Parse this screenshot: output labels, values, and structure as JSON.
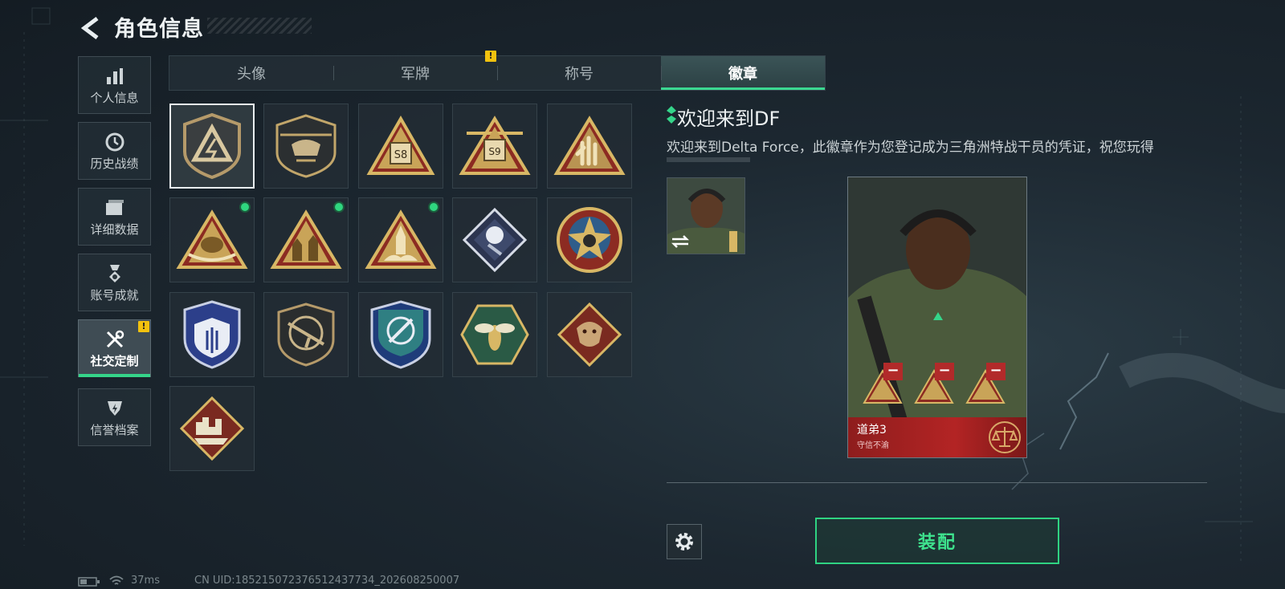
{
  "header": {
    "title": "角色信息",
    "back_icon": "chevron-left-icon"
  },
  "sidebar": {
    "items": [
      {
        "label": "个人信息",
        "icon": "bar-chart-icon"
      },
      {
        "label": "历史战绩",
        "icon": "history-clock-icon"
      },
      {
        "label": "详细数据",
        "icon": "folder-data-icon"
      },
      {
        "label": "账号成就",
        "icon": "medal-icon"
      },
      {
        "label": "社交定制",
        "icon": "tools-icon",
        "active": true,
        "warning": "!"
      },
      {
        "label": "信誉档案",
        "icon": "shield-bolt-icon"
      }
    ]
  },
  "tabs": [
    {
      "label": "头像"
    },
    {
      "label": "军牌",
      "warning": "!"
    },
    {
      "label": "称号"
    },
    {
      "label": "徽章",
      "active": true
    }
  ],
  "badges": [
    {
      "name": "delta-shield-badge",
      "selected": true
    },
    {
      "name": "helicopter-badge"
    },
    {
      "name": "s8-badge"
    },
    {
      "name": "s9-badge"
    },
    {
      "name": "hand-sign-badge"
    },
    {
      "name": "eagle-triangle-badge",
      "new": true
    },
    {
      "name": "soldiers-triangle-badge",
      "new": true
    },
    {
      "name": "rocket-triangle-badge",
      "new": true
    },
    {
      "name": "rose-diamond-badge"
    },
    {
      "name": "star-round-badge"
    },
    {
      "name": "blue-shield-badge"
    },
    {
      "name": "rifle-badge"
    },
    {
      "name": "target-blue-badge"
    },
    {
      "name": "hornet-hex-badge"
    },
    {
      "name": "dragon-diamond-badge"
    },
    {
      "name": "city-diamond-badge"
    }
  ],
  "detail": {
    "title": "欢迎来到DF",
    "description": "欢迎来到Delta Force，此徽章作为您登记成为三角洲特战干员的凭证，祝您玩得"
  },
  "card": {
    "name": "道弟3",
    "subtitle": "守信不渝"
  },
  "actions": {
    "equip_label": "装配"
  },
  "footer": {
    "ping": "37ms",
    "uid": "CN UID:18521507237651243​7734_202608250007"
  },
  "colors": {
    "accent": "#35d58a",
    "warning": "#f2c20f",
    "card_red": "#b32424"
  }
}
